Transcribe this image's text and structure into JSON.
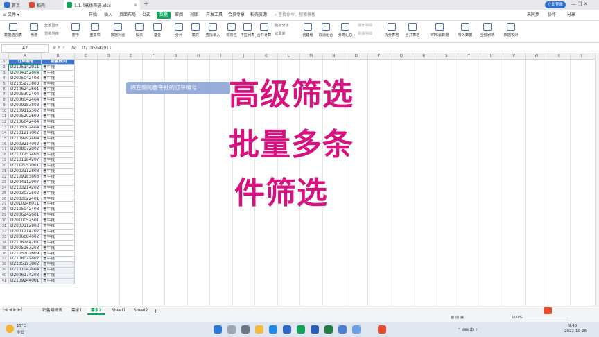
{
  "titlebar": {
    "tabs": [
      {
        "label": "首页",
        "color": "#2b6fd6"
      },
      {
        "label": "稻壳",
        "color": "#e44b2d"
      },
      {
        "label": "1.1.4高级筛选.xlsx",
        "color": "#12a35a"
      }
    ],
    "new_tab": "+",
    "login": "立即登录"
  },
  "menubar": {
    "file": "文件",
    "items": [
      "开始",
      "插入",
      "页面布局",
      "公式",
      "数据",
      "审阅",
      "视图",
      "开发工具",
      "会员专享",
      "稻壳资源"
    ],
    "active": "数据",
    "search_placeholder": "查找命令、搜索模板",
    "right": [
      "未同步",
      "协作",
      "分享"
    ]
  },
  "ribbon": {
    "buttons": [
      "数据透视表",
      "筛选",
      "排序",
      "重复项",
      "数据对比",
      "股票",
      "基金",
      "分列",
      "填充",
      "查找录入",
      "有效性",
      "下拉列表",
      "合并计算",
      "创建组",
      "取消组合",
      "分类汇总",
      "拆分表格",
      "合并表格",
      "WPS云数据",
      "导入数据",
      "全部刷新",
      "数据校对"
    ],
    "small": [
      "全部显示",
      "重新应用",
      "模拟分析",
      "记录单",
      "展开明细",
      "折叠明细"
    ]
  },
  "formula_bar": {
    "cell": "A2",
    "fx": "fx",
    "value": "D2105142911"
  },
  "columns": [
    "A",
    "B",
    "C",
    "D",
    "E",
    "F",
    "G",
    "H",
    "I",
    "J",
    "K",
    "L",
    "M",
    "N",
    "O",
    "P",
    "Q",
    "R",
    "S",
    "T",
    "U",
    "V",
    "W",
    "X",
    "Y",
    "Z"
  ],
  "table": {
    "headers": [
      "订单编号",
      "销售顾问"
    ],
    "rows": [
      [
        "D2105142911",
        "曹牛批"
      ],
      [
        "D2004152804",
        "曹牛批"
      ],
      [
        "D2005042403",
        "曹牛批"
      ],
      [
        "D2105273803",
        "曹牛批"
      ],
      [
        "D2106242601",
        "曹牛批"
      ],
      [
        "D2005302404",
        "曹牛批"
      ],
      [
        "D2006042404",
        "曹牛批"
      ],
      [
        "D2009183803",
        "曹牛批"
      ],
      [
        "D2109112502",
        "曹牛批"
      ],
      [
        "D2005202609",
        "曹牛批"
      ],
      [
        "D2106042404",
        "曹牛批"
      ],
      [
        "D2105302404",
        "曹牛批"
      ],
      [
        "D2101217002",
        "曹牛批"
      ],
      [
        "D2109292404",
        "曹牛批"
      ],
      [
        "D2003214002",
        "曹牛批"
      ],
      [
        "D2008072802",
        "曹牛批"
      ],
      [
        "D2107252403",
        "曹牛批"
      ],
      [
        "D2101184207",
        "曹牛批"
      ],
      [
        "D2112057001",
        "曹牛批"
      ],
      [
        "D2003112803",
        "曹牛批"
      ],
      [
        "D2109183803",
        "曹牛批"
      ],
      [
        "D2004112907",
        "曹牛批"
      ],
      [
        "D2103214202",
        "曹牛批"
      ],
      [
        "D2003032502",
        "曹牛批"
      ],
      [
        "D2003022401",
        "曹牛批"
      ],
      [
        "D2010246011",
        "曹牛批"
      ],
      [
        "D2105042403",
        "曹牛批"
      ],
      [
        "D2006242601",
        "曹牛批"
      ],
      [
        "D2010052501",
        "曹牛批"
      ],
      [
        "D2003112803",
        "曹牛批"
      ],
      [
        "D2001214202",
        "曹牛批"
      ],
      [
        "D2006084002",
        "曹牛批"
      ],
      [
        "D2108284201",
        "曹牛批"
      ],
      [
        "D2005163203",
        "曹牛批"
      ],
      [
        "D2105202609",
        "曹牛批"
      ],
      [
        "D2108072802",
        "曹牛批"
      ],
      [
        "D2105193802",
        "曹牛批"
      ],
      [
        "D2101042404",
        "曹牛批"
      ],
      [
        "D2006174203",
        "曹牛批"
      ],
      [
        "D2109244001",
        "曹牛批"
      ]
    ]
  },
  "caption": "将左侧的曹牛批的订单编号",
  "overlay": {
    "line1": "高级筛选",
    "line2": "批量多条",
    "line3": "件筛选",
    "color": "#d6127f"
  },
  "sheets": {
    "tabs": [
      "销售明细表",
      "需求1",
      "需求2",
      "Sheet1",
      "Sheet2"
    ],
    "active": "需求2",
    "add": "+"
  },
  "statusbar": {
    "zoom": "100%"
  },
  "taskbar": {
    "weather_temp": "15°C",
    "weather_desc": "多云",
    "time": "9:45",
    "date": "2022-10-28"
  }
}
